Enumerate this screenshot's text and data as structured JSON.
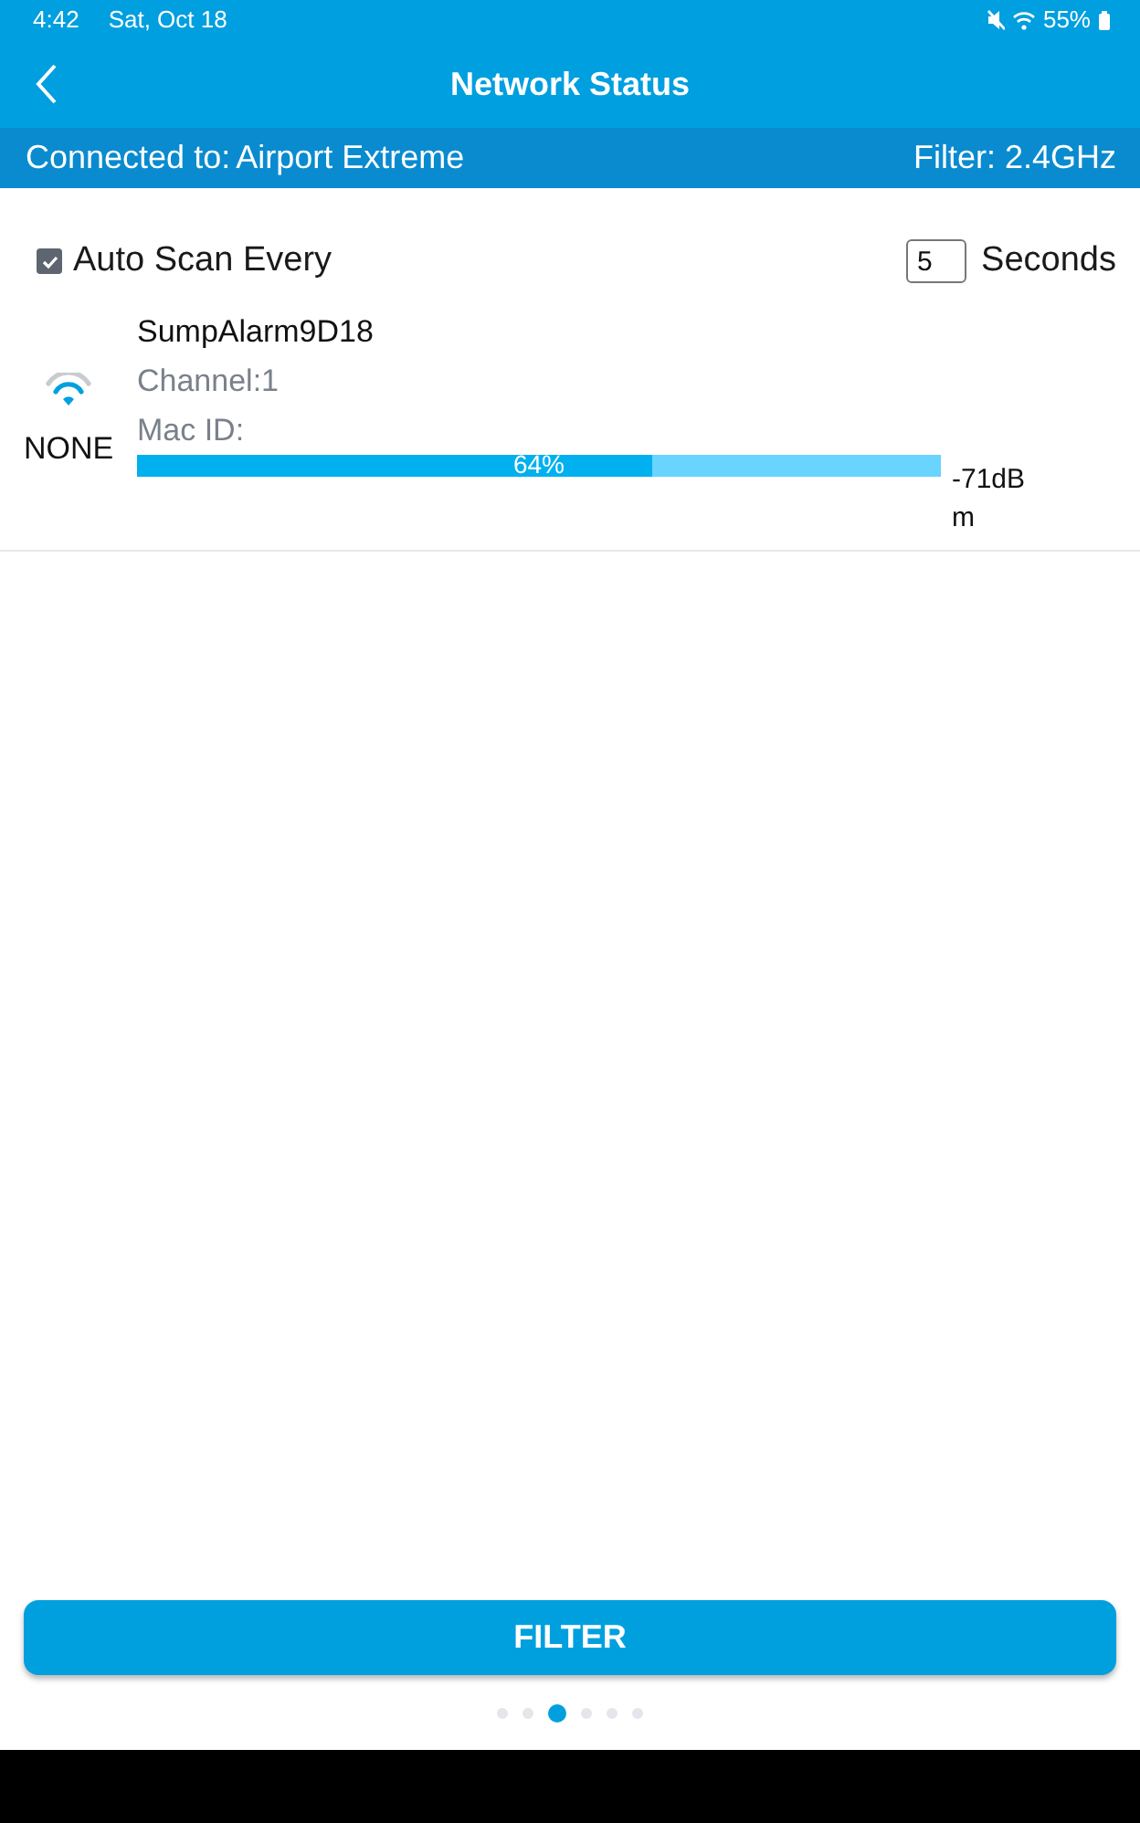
{
  "status_bar": {
    "time": "4:42",
    "date": "Sat, Oct 18",
    "battery": "55%"
  },
  "header": {
    "title": "Network Status"
  },
  "connection_bar": {
    "connected_label": "Connected to:",
    "network": "Airport Extreme",
    "filter": "Filter: 2.4GHz"
  },
  "auto_scan": {
    "label": "Auto Scan Every",
    "checked": true,
    "interval": "5",
    "unit": "Seconds"
  },
  "networks": [
    {
      "name": "SumpAlarm9D18",
      "security": "NONE",
      "channel": "Channel:1",
      "mac_id": "Mac ID:",
      "level": 0.64,
      "percent": "64%",
      "signal": "-71dBm"
    }
  ],
  "filter_button": {
    "label": "FILTER"
  },
  "page_dots": [
    {
      "selected": false
    },
    {
      "selected": false
    },
    {
      "selected": true
    },
    {
      "selected": false
    },
    {
      "selected": false
    },
    {
      "selected": false
    }
  ]
}
